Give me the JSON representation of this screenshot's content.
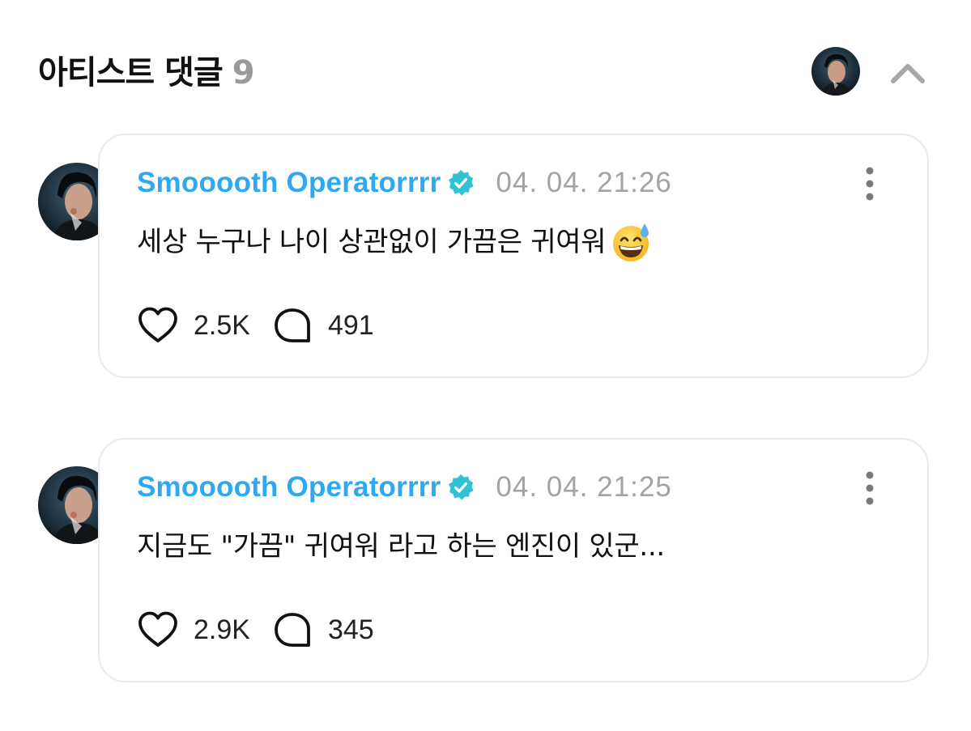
{
  "header": {
    "title": "아티스트 댓글",
    "count": "9",
    "avatar_icon": "artist-avatar",
    "collapse_icon": "chevron-up-icon"
  },
  "colors": {
    "author": "#2ea8f0",
    "verified_badge": "#2ec4d6",
    "timestamp": "#a3a3a3",
    "card_border": "#ebebeb",
    "muted_count": "#9a9a9a"
  },
  "comments": [
    {
      "author": "Smooooth Operatorrrr",
      "verified": true,
      "timestamp": "04. 04. 21:26",
      "text": "세상 누구나 나이 상관없이 가끔은 귀여워",
      "emoji": "grinning-face-with-sweat",
      "likes": "2.5K",
      "replies": "491"
    },
    {
      "author": "Smooooth Operatorrrr",
      "verified": true,
      "timestamp": "04. 04. 21:25",
      "text": "지금도 \"가끔\" 귀여워 라고 하는 엔진이 있군...",
      "likes": "2.9K",
      "replies": "345"
    }
  ]
}
